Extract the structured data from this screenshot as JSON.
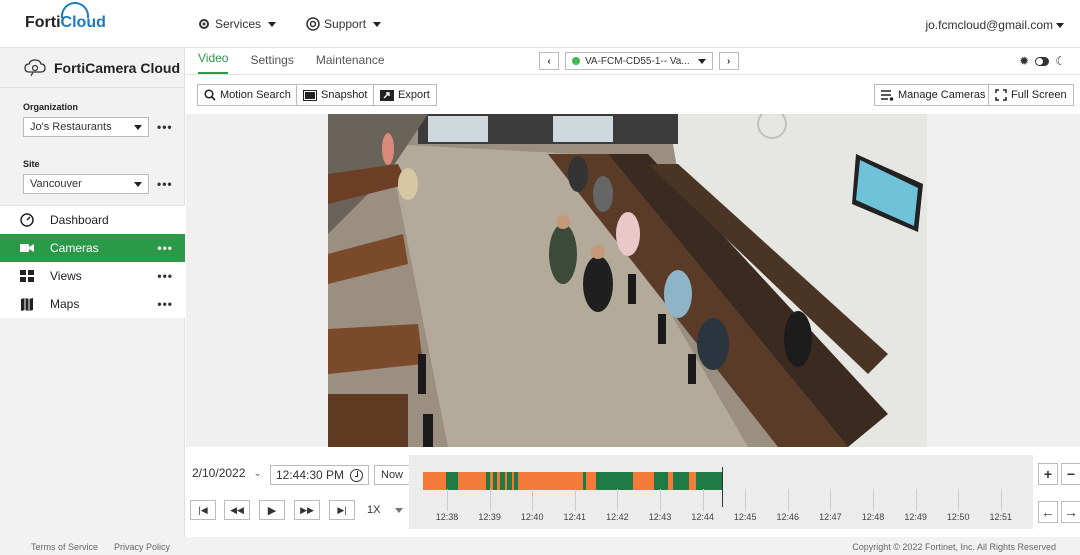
{
  "brand": {
    "logo_part1": "Forti",
    "logo_part2": "Cloud"
  },
  "topnav": {
    "services": "Services",
    "support": "Support",
    "user": "jo.fcmcloud@gmail.com"
  },
  "sidebar": {
    "app_title": "FortiCamera Cloud",
    "organization_label": "Organization",
    "organization_value": "Jo's Restaurants",
    "site_label": "Site",
    "site_value": "Vancouver",
    "items": [
      {
        "label": "Dashboard",
        "icon": "dashboard-icon",
        "active": false
      },
      {
        "label": "Cameras",
        "icon": "camera-icon",
        "active": true
      },
      {
        "label": "Views",
        "icon": "views-icon",
        "active": false
      },
      {
        "label": "Maps",
        "icon": "map-icon",
        "active": false
      }
    ]
  },
  "tabs": [
    "Video",
    "Settings",
    "Maintenance"
  ],
  "camera_select": {
    "value": "VA-FCM-CD55-1-- Va...",
    "status_color": "#3fb950"
  },
  "toolbar": {
    "motion_search": "Motion Search",
    "snapshot": "Snapshot",
    "export": "Export",
    "manage_cameras": "Manage Cameras",
    "full_screen": "Full Screen"
  },
  "timeline": {
    "date": "2/10/2022",
    "time": "12:44:30 PM",
    "now_label": "Now",
    "speed": "1X",
    "ticks": [
      "12:38",
      "12:39",
      "12:40",
      "12:41",
      "12:42",
      "12:43",
      "12:44",
      "12:45",
      "12:46",
      "12:47",
      "12:48",
      "12:49",
      "12:50",
      "12:51"
    ],
    "recording_color": "#f47a3a",
    "motion_color": "#1f7a45"
  },
  "footer": {
    "terms": "Terms of Service",
    "privacy": "Privacy Policy",
    "copyright": "Copyright © 2022 Fortinet, Inc. All Rights Reserved"
  },
  "colors": {
    "accent": "#2b9a48"
  }
}
